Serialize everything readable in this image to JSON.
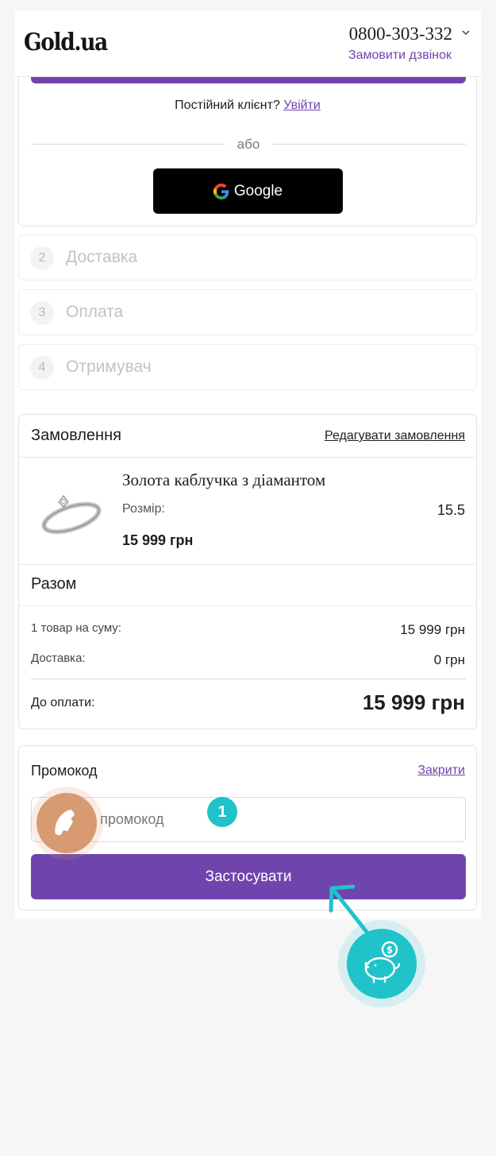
{
  "header": {
    "logo": "Gold.ua",
    "phone": "0800-303-332",
    "callback_label": "Замовити дзвінок"
  },
  "login": {
    "client_prompt": "Постійний клієнт?",
    "login_link": "Увійти",
    "or_label": "або",
    "google_label": "Google"
  },
  "steps": [
    {
      "number": "2",
      "label": "Доставка"
    },
    {
      "number": "3",
      "label": "Оплата"
    },
    {
      "number": "4",
      "label": "Отримувач"
    }
  ],
  "order": {
    "title": "Замовлення",
    "edit_link": "Редагувати замовлення",
    "product": {
      "name": "Золота каблучка з діамантом",
      "size_label": "Розмір:",
      "size_value": "15.5",
      "price": "15 999 грн"
    },
    "totals": {
      "title": "Разом",
      "items_label": "1 товар на суму:",
      "items_value": "15 999 грн",
      "delivery_label": "Доставка:",
      "delivery_value": "0 грн",
      "pay_label": "До оплати:",
      "pay_value": "15 999 грн"
    }
  },
  "promo": {
    "title": "Промокод",
    "close_link": "Закрити",
    "placeholder": "Введіть промокод",
    "apply_label": "Застосувати"
  },
  "overlays": {
    "badge_count": "1",
    "call_icon": "phone-icon",
    "bank_icon": "piggy-bank-icon"
  },
  "colors": {
    "accent": "#7044ad",
    "call_fab": "#d89a72",
    "teal": "#1fc3c9"
  }
}
